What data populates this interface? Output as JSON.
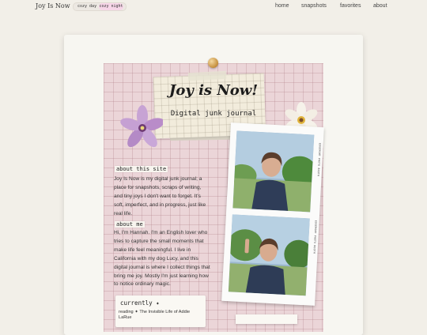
{
  "header": {
    "logo": "Joy Is Now",
    "toggle": {
      "day_label": "cozy day",
      "night_label": "cozy night",
      "active": "cozy night"
    },
    "nav": [
      "home",
      "snapshots",
      "favorites",
      "about"
    ]
  },
  "journal": {
    "title": "Joy is Now!",
    "subtitle": "Digital junk journal",
    "about_site": {
      "heading": "about this site",
      "text": "Joy Is Now is my digital junk journal; a place for snapshots, scraps of writing, and tiny joys I don't want to forget. It's soft, imperfect, and in progress, just like real life."
    },
    "about_me": {
      "heading": "about me",
      "text": "Hi, I'm Hannah. I'm an English lover who tries to capture the small moments that make life feel meaningful. I live in California with my dog Lucy, and this digital journal is where I collect things that bring me joy. Mostly I'm just learning how to notice ordinary magic."
    },
    "currently": {
      "heading": "currently ✦",
      "text": "reading ✦ The Invisible Life of Addie LaRue"
    },
    "photo_strip_text": "EDGEMONT PHOTO BOOTH"
  },
  "colors": {
    "page_bg": "#f2efe8",
    "paper_pink": "#ebd5d8",
    "toggle_active": "#f7d6e8"
  }
}
